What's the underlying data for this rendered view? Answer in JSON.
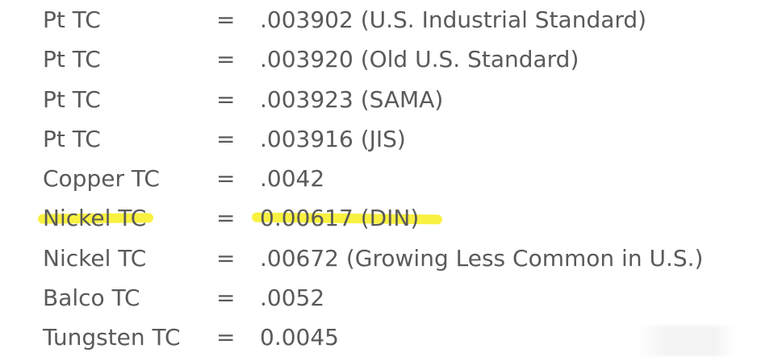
{
  "rows": [
    {
      "name": "Pt TC",
      "eq": "=",
      "value": ".003902 (U.S. Industrial Standard)"
    },
    {
      "name": "Pt TC",
      "eq": "=",
      "value": ".003920 (Old U.S. Standard)"
    },
    {
      "name": "Pt TC",
      "eq": "=",
      "value": ".003923 (SAMA)"
    },
    {
      "name": "Pt TC",
      "eq": "=",
      "value": ".003916 (JIS)"
    },
    {
      "name": "Copper TC",
      "eq": "=",
      "value": ".0042"
    },
    {
      "name": "Nickel TC",
      "eq": "=",
      "value": "0.00617 (DIN)"
    },
    {
      "name": "Nickel TC",
      "eq": "=",
      "value": ".00672 (Growing Less Common in U.S.)"
    },
    {
      "name": "Balco TC",
      "eq": "=",
      "value": ".0052"
    },
    {
      "name": "Tungsten TC",
      "eq": "=",
      "value": "0.0045"
    }
  ],
  "highlight_color": "#f7ef2b",
  "text_color": "#5a5a5a"
}
